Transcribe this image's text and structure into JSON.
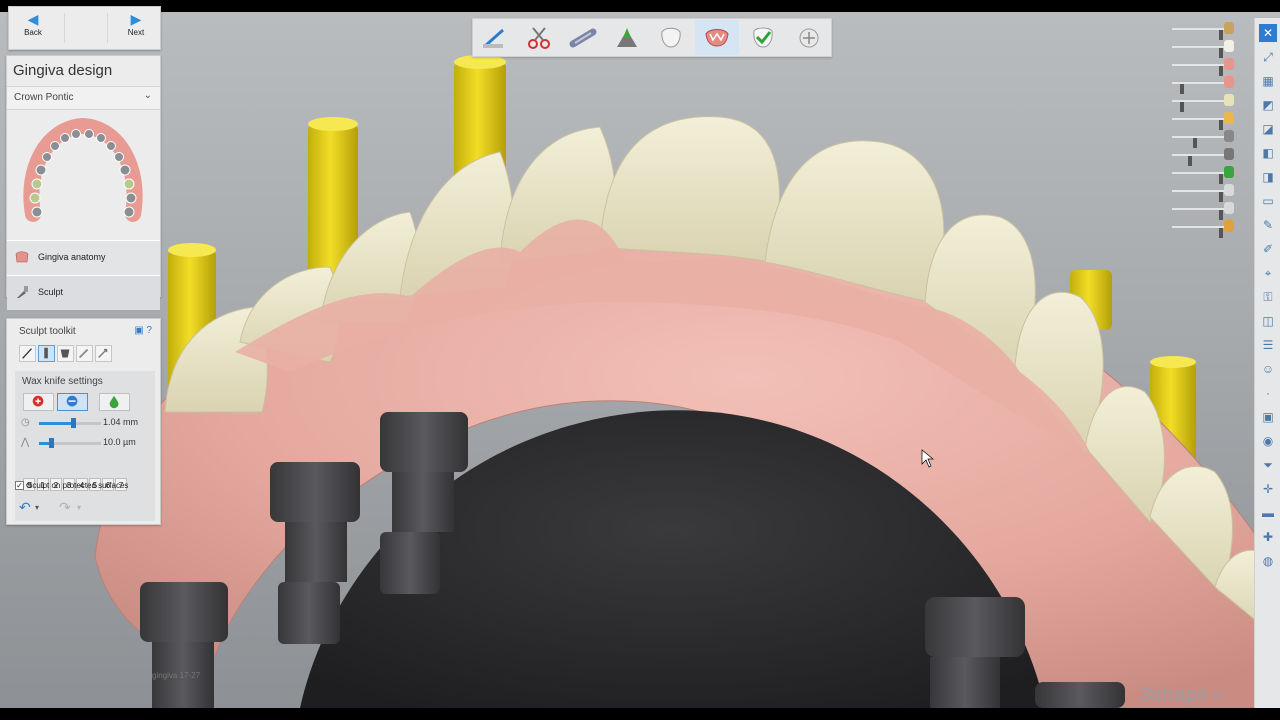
{
  "navigation": {
    "back_label": "Back",
    "next_label": "Next"
  },
  "panel": {
    "title": "Gingiva design",
    "mode": "Crown Pontic",
    "steps": [
      {
        "label": "Gingiva anatomy",
        "icon": "gingiva-icon"
      },
      {
        "label": "Sculpt",
        "icon": "sculpt-icon"
      }
    ]
  },
  "toolkit": {
    "title": "Sculpt toolkit",
    "tools": [
      "wax-knife-icon",
      "smooth-icon",
      "add-remove-icon",
      "morph-icon",
      "scale-icon"
    ],
    "wax_knife": {
      "title": "Wax knife settings",
      "modes": [
        "add-icon",
        "remove-icon",
        "smooth-drop-icon"
      ],
      "radius_value": "1.04 mm",
      "radius_level": 0.55,
      "height_value": "10.0 µm",
      "height_level": 0.2,
      "presets": [
        "1",
        "2",
        "3",
        "4",
        "5",
        "6",
        "7"
      ],
      "protect_label": "Sculpt on protected surfaces",
      "protect_checked": true
    }
  },
  "toolbar_icons": [
    "trim-icon",
    "cut-icon",
    "connector-icon",
    "gingiva-shape-icon",
    "crown-icon",
    "gingiva-icon",
    "tooth-check-icon",
    "finish-icon"
  ],
  "right_toolbar_icons": [
    "close-icon",
    "fullscreen-icon",
    "view-front-icon",
    "view-top-icon",
    "view-left-icon",
    "view-right-icon",
    "view-back-icon",
    "view-bottom-icon",
    "knife-icon",
    "pen-icon",
    "measure-icon",
    "lock-icon",
    "clip-icon",
    "layers-icon",
    "face-icon",
    "blank-icon",
    "image-icon",
    "tooth-icon",
    "filter-icon",
    "axis-icon",
    "minus-icon",
    "plus-icon",
    "color-icon"
  ],
  "visibility_items": [
    "gingiva-model",
    "crown-layer",
    "gum-layer",
    "tooth-layer",
    "shading-layer",
    "antagonist-layer",
    "implant-layer",
    "screw-layer",
    "cap-layer"
  ],
  "caption": "gingiva 17-27",
  "brand": "3shape",
  "colors": {
    "accent": "#2f8ed8",
    "gum": "#e8aea6",
    "tooth": "#ebe6c8",
    "screw": "#e6d21a",
    "analog": "#4a4a4d"
  }
}
